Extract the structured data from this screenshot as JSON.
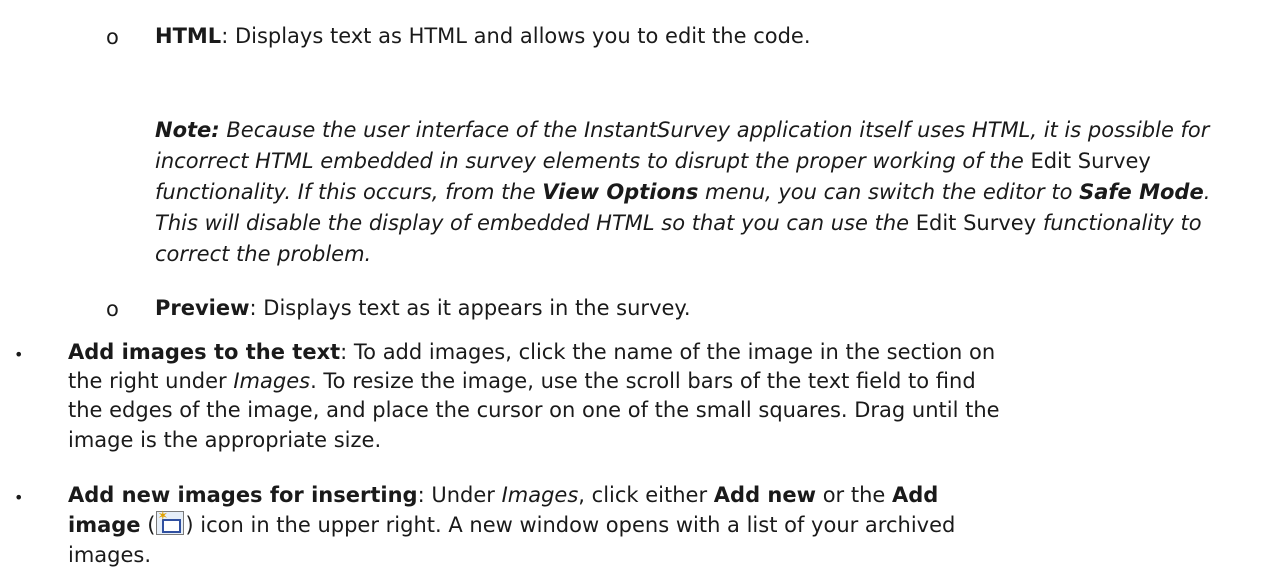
{
  "html_item": {
    "bullet": "o",
    "term": "HTML",
    "desc": ": Displays text as HTML and allows you to edit the code."
  },
  "note": {
    "label": "Note:",
    "t1": " Because the user interface of the InstantSurvey application itself uses HTML, it is possible for incorrect HTML embedded in survey elements to disrupt the proper working of the ",
    "edit_survey_1": "Edit Survey",
    "t2": " functionality. If this occurs, from the ",
    "view_options": "View Options",
    "t3": " menu, you can switch the editor to ",
    "safe_mode": "Safe Mode",
    "t4": ". This will disable the display of embedded HTML so that you can use the ",
    "edit_survey_2": "Edit Survey",
    "t5": " functionality to correct the problem."
  },
  "preview_item": {
    "bullet": "o",
    "term": "Preview",
    "desc": ": Displays text as it appears in the survey."
  },
  "add_images": {
    "bullet": "•",
    "term": "Add images to the text",
    "line1": ": To add images, click the name of the image in the section on",
    "line2a": "the right under ",
    "images_word": "Images",
    "line2b": ". To resize the image, use the scroll bars of the text field to find",
    "line3": "the edges of the image, and place the cursor on one of the small squares. Drag until the",
    "line4": "image is the appropriate size."
  },
  "add_new_images": {
    "bullet": "•",
    "term": "Add new images for inserting",
    "line1a": ": Under ",
    "images_word": "Images",
    "line1b": ", click either ",
    "add_new": "Add new",
    "line1c": " or the ",
    "add_image_1": "Add",
    "add_image_2": "image",
    "line2a": " (",
    "line2b": ") icon in the upper right. A new window opens with a list of your archived",
    "line3": "images."
  }
}
